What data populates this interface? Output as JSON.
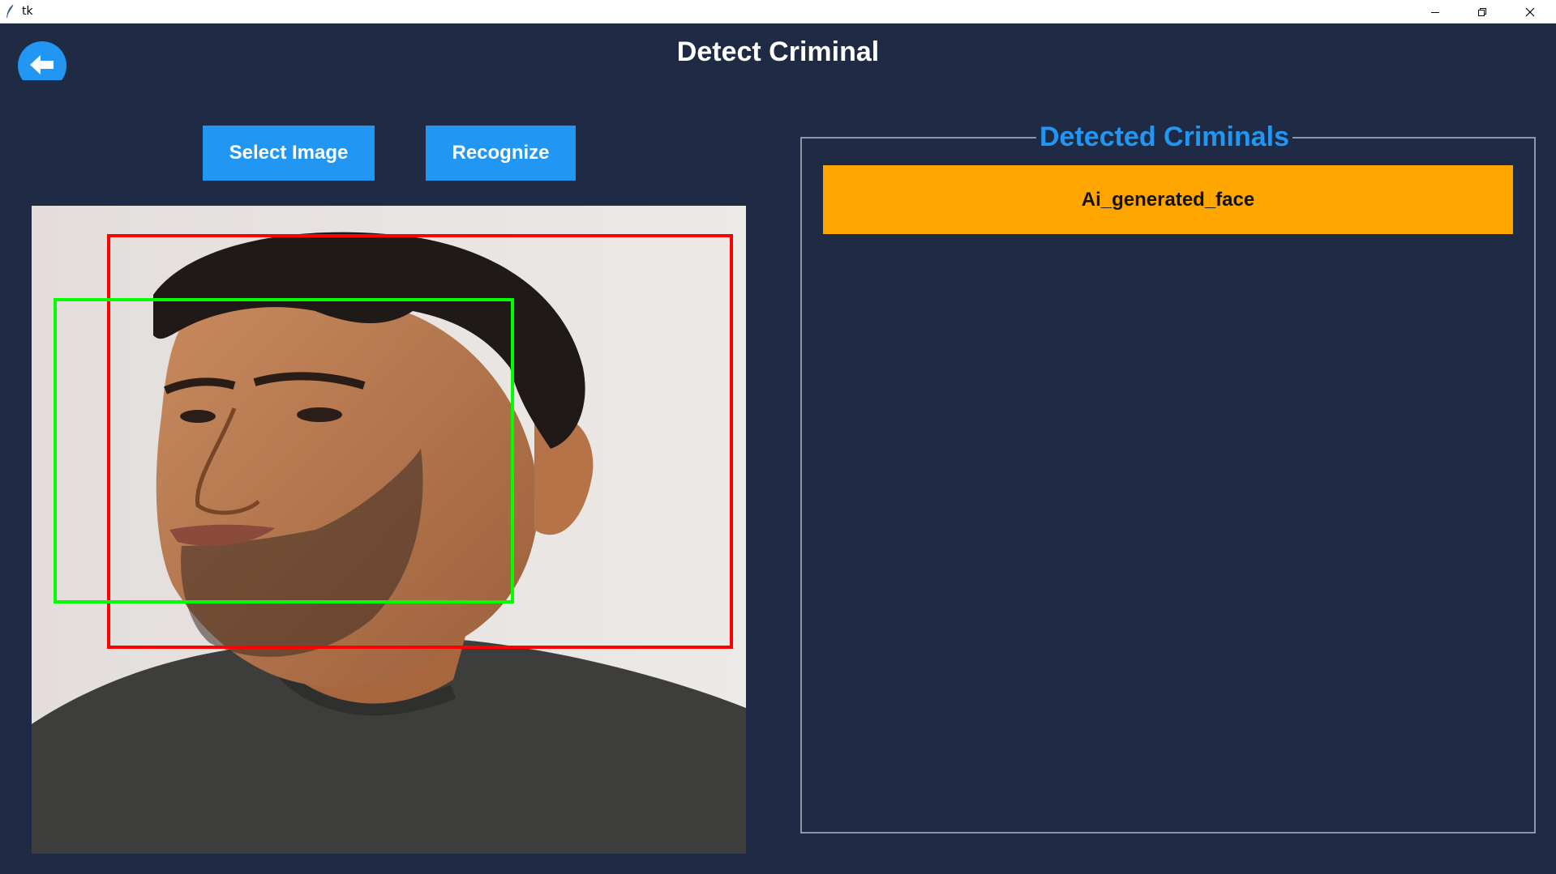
{
  "window": {
    "title": "tk",
    "app_icon": "feather-icon",
    "controls": [
      "minimize-icon",
      "restore-icon",
      "close-icon"
    ]
  },
  "header": {
    "back_icon": "arrow-left-icon",
    "title": "Detect Criminal"
  },
  "toolbar": {
    "select_image_label": "Select Image",
    "recognize_label": "Recognize"
  },
  "image_view": {
    "content": "photo of a man's face with two detection boxes",
    "box_colors": [
      "#ff0000",
      "#00ff00"
    ]
  },
  "detected_panel": {
    "title": "Detected Criminals",
    "items": [
      {
        "label": "Ai_generated_face"
      }
    ]
  },
  "colors": {
    "background": "#1f2a44",
    "accent": "#2196f3",
    "result": "#ffa500"
  }
}
